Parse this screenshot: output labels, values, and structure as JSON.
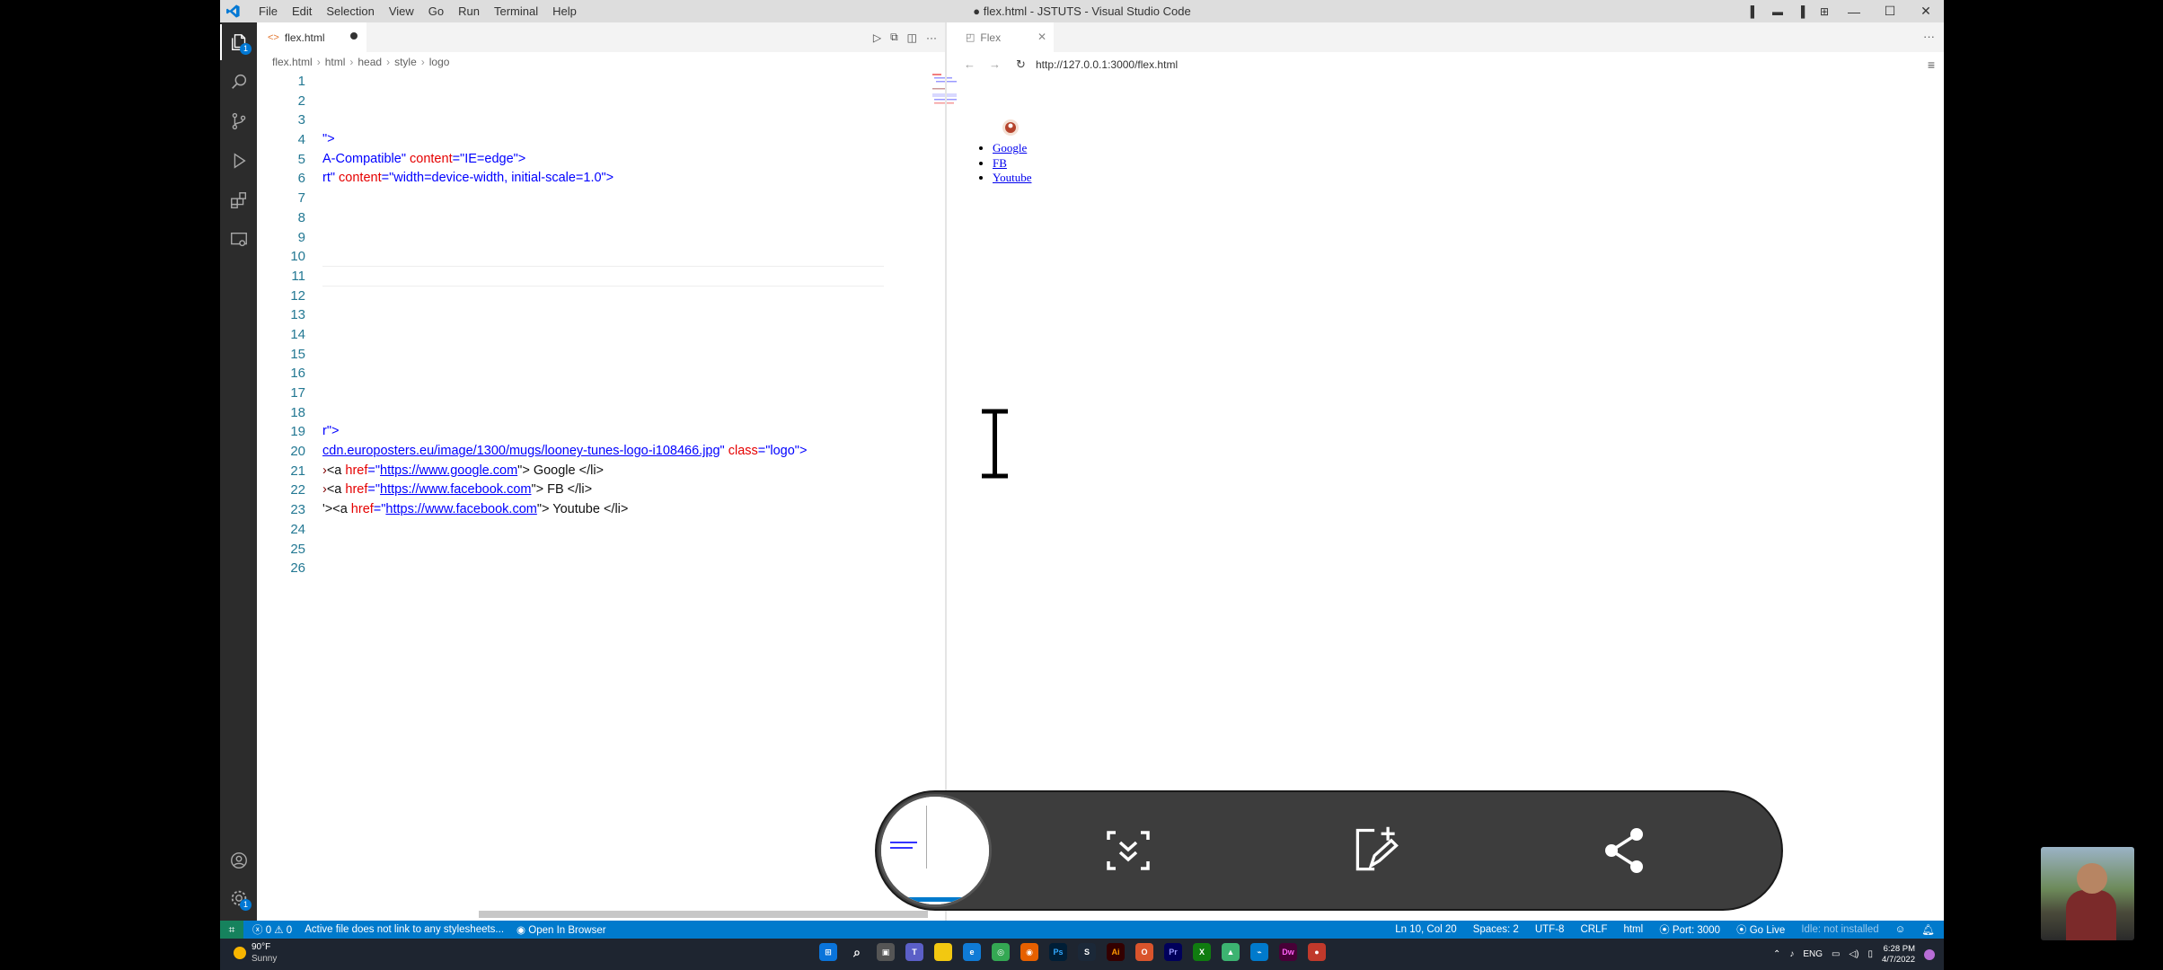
{
  "window": {
    "title": "● flex.html - JSTUTS - Visual Studio Code",
    "menu": [
      "File",
      "Edit",
      "Selection",
      "View",
      "Go",
      "Run",
      "Terminal",
      "Help"
    ]
  },
  "activity": {
    "explorer_badge": "1",
    "accounts_badge": "1"
  },
  "editor": {
    "tab_label": "flex.html",
    "breadcrumb": [
      "flex.html",
      "html",
      "head",
      "style",
      "logo"
    ],
    "line_numbers": [
      "1",
      "2",
      "3",
      "4",
      "5",
      "6",
      "7",
      "8",
      "9",
      "10",
      "11",
      "12",
      "13",
      "14",
      "15",
      "16",
      "17",
      "18",
      "19",
      "20",
      "21",
      "22",
      "23",
      "24",
      "25",
      "26"
    ],
    "lines": {
      "l4": "\">",
      "l5_a": "A-Compatible\"",
      "l5_b": " content",
      "l5_c": "=\"IE=edge\">",
      "l6_a": "rt\"",
      "l6_b": " content",
      "l6_c": "=\"width=device-width, initial-scale=1.0\">",
      "l19": "r\">",
      "l20_url": "cdn.europosters.eu/image/1300/mugs/looney-tunes-logo-i108466.jpg",
      "l20_q": "\"",
      "l20_attr": " class",
      "l20_val": "=\"logo\">",
      "l21_a": "<a ",
      "l21_b": "href",
      "l21_c": "=\"",
      "l21_url": "https://www.google.com",
      "l21_d": "\"> Google </li>",
      "l22_a": "<a ",
      "l22_b": "href",
      "l22_c": "=\"",
      "l22_url": "https://www.facebook.com",
      "l22_d": "\"> FB </li>",
      "l23_a": "'><a ",
      "l23_b": "href",
      "l23_c": "=\"",
      "l23_url": "https://www.facebook.com",
      "l23_d": "\"> Youtube </li>"
    }
  },
  "browser": {
    "tab_label": "Flex",
    "url": "http://127.0.0.1:3000/flex.html",
    "links": [
      "Google",
      "FB",
      "Youtube"
    ]
  },
  "statusbar": {
    "problems": "0 ⚠ 0",
    "message": "Active file does not link to any stylesheets...",
    "open_browser": "Open In Browser",
    "position": "Ln 10, Col 20",
    "spaces": "Spaces: 2",
    "encoding": "UTF-8",
    "eol": "CRLF",
    "language": "html",
    "port": "Port: 3000",
    "golive": "Go Live",
    "idle": "Idle: not installed"
  },
  "taskbar": {
    "temp": "90°F",
    "weather": "Sunny",
    "lang": "ENG",
    "time": "6:28 PM",
    "date": "4/7/2022"
  },
  "colors": {
    "statusbar": "#007acc",
    "activitybar": "#2c2c2c",
    "titlebar": "#dddddd",
    "link": "#0000ee"
  }
}
